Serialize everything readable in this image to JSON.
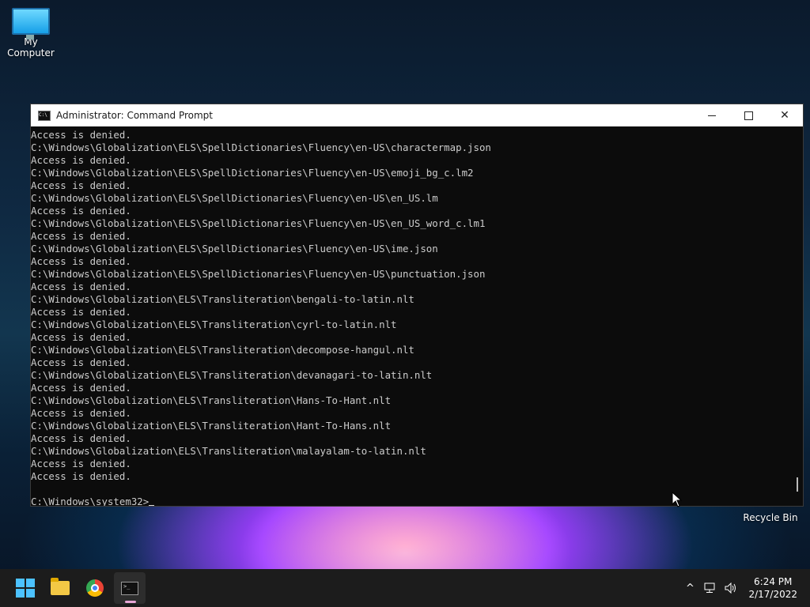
{
  "desktop": {
    "my_computer_label": "My Computer",
    "recycle_bin_label": "Recycle Bin"
  },
  "window": {
    "title": "Administrator: Command Prompt",
    "title_icon_text": "C:\\",
    "minimize_glyph": "",
    "maximize_glyph": "",
    "close_glyph": "✕"
  },
  "console": {
    "lines": [
      "Access is denied.",
      "C:\\Windows\\Globalization\\ELS\\SpellDictionaries\\Fluency\\en-US\\charactermap.json",
      "Access is denied.",
      "C:\\Windows\\Globalization\\ELS\\SpellDictionaries\\Fluency\\en-US\\emoji_bg_c.lm2",
      "Access is denied.",
      "C:\\Windows\\Globalization\\ELS\\SpellDictionaries\\Fluency\\en-US\\en_US.lm",
      "Access is denied.",
      "C:\\Windows\\Globalization\\ELS\\SpellDictionaries\\Fluency\\en-US\\en_US_word_c.lm1",
      "Access is denied.",
      "C:\\Windows\\Globalization\\ELS\\SpellDictionaries\\Fluency\\en-US\\ime.json",
      "Access is denied.",
      "C:\\Windows\\Globalization\\ELS\\SpellDictionaries\\Fluency\\en-US\\punctuation.json",
      "Access is denied.",
      "C:\\Windows\\Globalization\\ELS\\Transliteration\\bengali-to-latin.nlt",
      "Access is denied.",
      "C:\\Windows\\Globalization\\ELS\\Transliteration\\cyrl-to-latin.nlt",
      "Access is denied.",
      "C:\\Windows\\Globalization\\ELS\\Transliteration\\decompose-hangul.nlt",
      "Access is denied.",
      "C:\\Windows\\Globalization\\ELS\\Transliteration\\devanagari-to-latin.nlt",
      "Access is denied.",
      "C:\\Windows\\Globalization\\ELS\\Transliteration\\Hans-To-Hant.nlt",
      "Access is denied.",
      "C:\\Windows\\Globalization\\ELS\\Transliteration\\Hant-To-Hans.nlt",
      "Access is denied.",
      "C:\\Windows\\Globalization\\ELS\\Transliteration\\malayalam-to-latin.nlt",
      "Access is denied.",
      "Access is denied.",
      "",
      "C:\\Windows\\system32>"
    ]
  },
  "taskbar": {
    "items": [
      {
        "name": "start-button",
        "icon": "windows-logo-icon"
      },
      {
        "name": "file-explorer-button",
        "icon": "folder-icon"
      },
      {
        "name": "chrome-button",
        "icon": "chrome-icon"
      },
      {
        "name": "command-prompt-button",
        "icon": "cmd-icon",
        "active": true
      }
    ],
    "tray": {
      "chevron_glyph": "^",
      "network_glyph": "🖧",
      "volume_glyph": "🔊",
      "time": "6:24 PM",
      "date": "2/17/2022"
    }
  },
  "colors": {
    "console_bg": "#0c0c0c",
    "console_fg": "#cccccc",
    "taskbar_bg": "#1c1c1c",
    "accent": "#4cc2ff"
  }
}
